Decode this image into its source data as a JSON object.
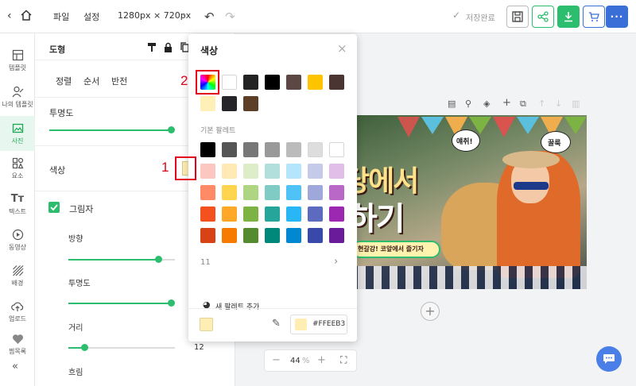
{
  "topbar": {
    "menu_file": "파일",
    "menu_settings": "설정",
    "canvas_size": "1280px × 720px",
    "save_status": "저장완료"
  },
  "rail": {
    "items": [
      {
        "label": "템플릿",
        "icon": "template-icon"
      },
      {
        "label": "나의 템플릿",
        "icon": "my-template-icon"
      },
      {
        "label": "사진",
        "icon": "photo-icon",
        "active": true
      },
      {
        "label": "요소",
        "icon": "element-icon"
      },
      {
        "label": "텍스트",
        "icon": "text-icon"
      },
      {
        "label": "동영상",
        "icon": "video-icon"
      },
      {
        "label": "배경",
        "icon": "background-icon"
      },
      {
        "label": "업로드",
        "icon": "upload-icon"
      },
      {
        "label": "찜목록",
        "icon": "heart-icon"
      }
    ]
  },
  "panel": {
    "title": "도형",
    "tabs": [
      "정렬",
      "순서",
      "반전"
    ],
    "opacity_label": "투명도",
    "color_label": "색상",
    "shadow_label": "그림자",
    "direction_label": "방향",
    "shadow_opacity_label": "투명도",
    "distance_label": "거리",
    "distance_value": "12",
    "blur_label": "흐림"
  },
  "color_popup": {
    "title": "색상",
    "recent_colors": [
      "#ffffff",
      "#222222",
      "#000000",
      "#5b4744",
      "#ffc400",
      "#4a3533",
      "#fff0b8",
      "#26262a",
      "#5c3f26"
    ],
    "basic_palette_label": "기본 팔레트",
    "palette_rows": [
      [
        "#000000",
        "#555555",
        "#777777",
        "#999999",
        "#bbbbbb",
        "#dddddd",
        "#ffffff"
      ],
      [
        "#fbc7c0",
        "#ffeab5",
        "#dcedc8",
        "#b2dfdb",
        "#b3e5fc",
        "#c5cae9",
        "#e1bee7"
      ],
      [
        "#ff8a65",
        "#ffd54f",
        "#aed581",
        "#80cbc4",
        "#4fc3f7",
        "#9fa8da",
        "#ba68c8"
      ],
      [
        "#f4511e",
        "#ffa726",
        "#7cb342",
        "#26a69a",
        "#29b6f6",
        "#5c6bc0",
        "#9c27b0"
      ],
      [
        "#d84315",
        "#f57c00",
        "#558b2f",
        "#00897b",
        "#0288d1",
        "#3949ab",
        "#6a1b9a"
      ]
    ],
    "more_colors": "11",
    "add_palette": "새 팔레트 추가",
    "current_hex": "#FFEEB3",
    "current_color": "#FFEEB3"
  },
  "annotations": {
    "marker_1": "1",
    "marker_2": "2"
  },
  "canvas": {
    "headline_line1": "당에서",
    "headline_line2": "하기",
    "subtitle": "현갈강! 코앞에서 즐기자",
    "bubble_left": "얘취!",
    "bubble_right": "꿀룩"
  },
  "zoom": {
    "value": "44",
    "unit": "%"
  }
}
